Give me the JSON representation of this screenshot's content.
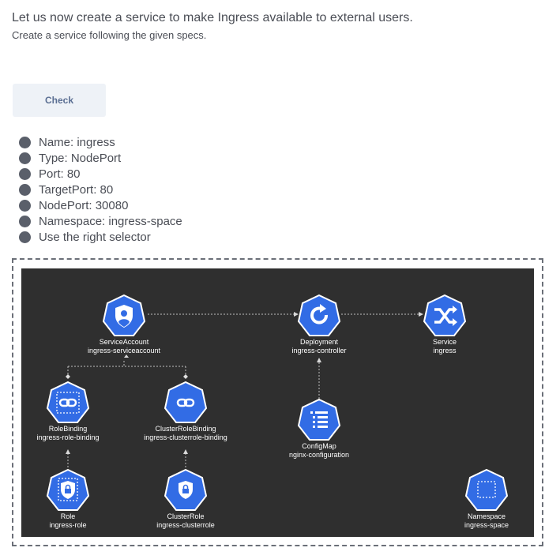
{
  "intro": {
    "title": "Let us now create a service to make Ingress available to external users.",
    "subtitle": "Create a service following the given specs."
  },
  "check_button": {
    "label": "Check"
  },
  "specs": [
    "Name: ingress",
    "Type: NodePort",
    "Port: 80",
    "TargetPort: 80",
    "NodePort: 30080",
    "Namespace: ingress-space",
    "Use the right selector"
  ],
  "diagram": {
    "colors": {
      "background": "#2f2f2f",
      "node": "#326ce5",
      "line": "#bfbfbf",
      "frame": "#6b6f78"
    },
    "nodes": {
      "serviceaccount": {
        "kind": "ServiceAccount",
        "name": "ingress-serviceaccount",
        "icon": "shield-user-icon"
      },
      "deployment": {
        "kind": "Deployment",
        "name": "ingress-controller",
        "icon": "refresh-icon"
      },
      "service": {
        "kind": "Service",
        "name": "ingress",
        "icon": "shuffle-icon"
      },
      "rolebinding": {
        "kind": "RoleBinding",
        "name": "ingress-role-binding",
        "icon": "link-icon"
      },
      "clusterrolebinding": {
        "kind": "ClusterRoleBinding",
        "name": "ingress-clusterrole-binding",
        "icon": "link-icon"
      },
      "configmap": {
        "kind": "ConfigMap",
        "name": "nginx-configuration",
        "icon": "list-icon"
      },
      "role": {
        "kind": "Role",
        "name": "ingress-role",
        "icon": "lock-icon"
      },
      "clusterrole": {
        "kind": "ClusterRole",
        "name": "ingress-clusterrole",
        "icon": "lock-icon"
      },
      "namespace": {
        "kind": "Namespace",
        "name": "ingress-space",
        "icon": "square-icon"
      }
    }
  }
}
